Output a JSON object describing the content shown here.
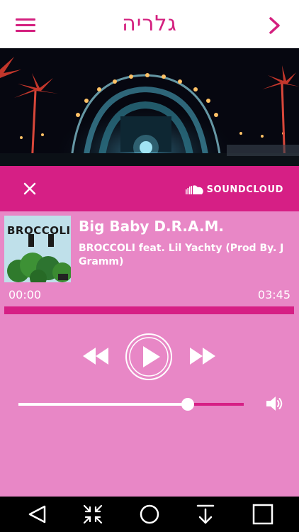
{
  "header": {
    "title": "גלריה",
    "menu_icon": "hamburger-menu-icon",
    "back_icon": "chevron-right-icon"
  },
  "hero": {
    "image": "concert-stage-photo"
  },
  "soundcloud_bar": {
    "close_icon": "close-icon",
    "logo_icon": "soundcloud-cloud-icon",
    "brand": "SOUNDCLOUD"
  },
  "track": {
    "title": "Big Baby D.R.A.M.",
    "artist": "BROCCOLI feat. Lil Yachty (Prod By. J Gramm)",
    "cover_text": "BROCCOLI",
    "current_time": "00:00",
    "duration": "03:45",
    "progress_fraction": 1.0
  },
  "controls": {
    "rewind_icon": "rewind-icon",
    "play_icon": "play-icon",
    "fast_forward_icon": "fast-forward-icon"
  },
  "volume": {
    "level_fraction": 0.75,
    "speaker_icon": "speaker-icon"
  },
  "nav_bar": {
    "back_icon": "triangle-back-icon",
    "collapse_icon": "collapse-arrows-icon",
    "home_icon": "circle-home-icon",
    "download_icon": "download-arrow-icon",
    "recents_icon": "square-recents-icon"
  },
  "colors": {
    "accent": "#d61f85",
    "header_text": "#d4207f",
    "player_bg": "#e887c6",
    "progress_bg": "#f2b6da"
  }
}
